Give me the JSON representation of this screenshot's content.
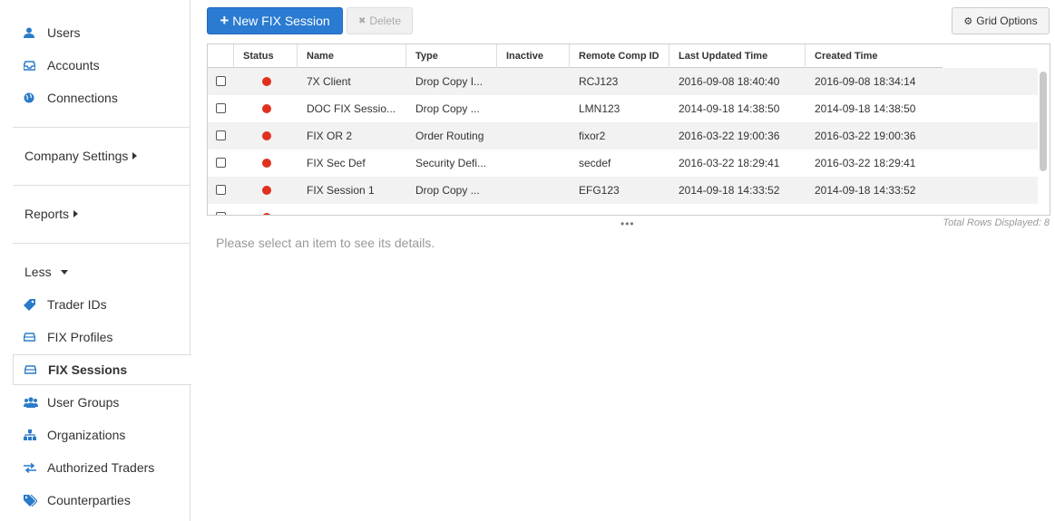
{
  "sidebar": {
    "items_top": [
      {
        "label": "Users",
        "icon": "user-icon"
      },
      {
        "label": "Accounts",
        "icon": "inbox-icon"
      },
      {
        "label": "Connections",
        "icon": "globe-icon"
      }
    ],
    "company_settings": "Company Settings",
    "reports": "Reports",
    "less": "Less",
    "items_bottom": [
      {
        "label": "Trader IDs",
        "icon": "tag-icon"
      },
      {
        "label": "FIX Profiles",
        "icon": "hdd-icon"
      },
      {
        "label": "FIX Sessions",
        "icon": "hdd-icon"
      },
      {
        "label": "User Groups",
        "icon": "users-icon"
      },
      {
        "label": "Organizations",
        "icon": "sitemap-icon"
      },
      {
        "label": "Authorized Traders",
        "icon": "exchange-icon"
      },
      {
        "label": "Counterparties",
        "icon": "tags-icon"
      }
    ],
    "active": "FIX Sessions"
  },
  "toolbar": {
    "new_label": "New FIX Session",
    "delete_label": "Delete",
    "grid_options_label": "Grid Options"
  },
  "colors": {
    "primary": "#2a7bd1",
    "status_red": "#e0301e",
    "icon_blue": "#2a7bc8"
  },
  "grid": {
    "columns": [
      "Status",
      "Name",
      "Type",
      "Inactive",
      "Remote Comp ID",
      "Last Updated Time",
      "Created Time"
    ],
    "rows": [
      {
        "name": "7X Client",
        "type": "Drop Copy I...",
        "inactive": "",
        "remote": "RCJ123",
        "updated": "2016-09-08 18:40:40",
        "created": "2016-09-08 18:34:14"
      },
      {
        "name": "DOC FIX Sessio...",
        "type": "Drop Copy ...",
        "inactive": "",
        "remote": "LMN123",
        "updated": "2014-09-18 14:38:50",
        "created": "2014-09-18 14:38:50"
      },
      {
        "name": "FIX OR 2",
        "type": "Order Routing",
        "inactive": "",
        "remote": "fixor2",
        "updated": "2016-03-22 19:00:36",
        "created": "2016-03-22 19:00:36"
      },
      {
        "name": "FIX Sec Def",
        "type": "Security Defi...",
        "inactive": "",
        "remote": "secdef",
        "updated": "2016-03-22 18:29:41",
        "created": "2016-03-22 18:29:41"
      },
      {
        "name": "FIX Session 1",
        "type": "Drop Copy ...",
        "inactive": "",
        "remote": "EFG123",
        "updated": "2014-09-18 14:33:52",
        "created": "2014-09-18 14:33:52"
      }
    ],
    "total_rows": "Total Rows Displayed: 8"
  },
  "details_placeholder": "Please select an item to see its details."
}
